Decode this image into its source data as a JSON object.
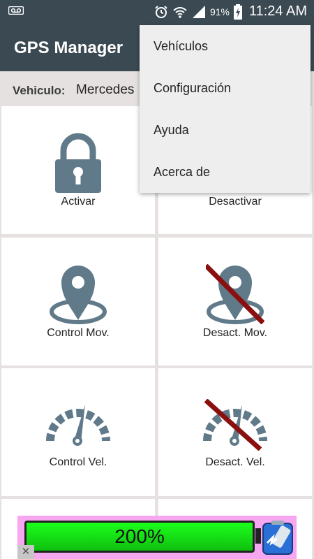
{
  "status_bar": {
    "battery_percent": "91%",
    "time": "11:24 AM",
    "icons": [
      "voicemail-icon",
      "alarm-icon",
      "wifi-icon",
      "signal-icon",
      "battery-charging-icon"
    ]
  },
  "app_bar": {
    "title": "GPS Manager"
  },
  "vehicle": {
    "label": "Vehiculo:",
    "value": "Mercedes"
  },
  "tiles": {
    "activar": {
      "label": "Activar",
      "icon": "lock-icon"
    },
    "desactivar": {
      "label": "Desactivar",
      "icon": "unlock-icon"
    },
    "control_mov": {
      "label": "Control Mov.",
      "icon": "location-pin-icon"
    },
    "desact_mov": {
      "label": "Desact. Mov.",
      "icon": "location-pin-disabled-icon"
    },
    "control_vel": {
      "label": "Control Vel.",
      "icon": "speedometer-icon"
    },
    "desact_vel": {
      "label": "Desact. Vel.",
      "icon": "speedometer-disabled-icon"
    }
  },
  "menu": {
    "items": [
      {
        "label": "Vehículos"
      },
      {
        "label": "Configuración"
      },
      {
        "label": "Ayuda"
      },
      {
        "label": "Acerca de"
      }
    ]
  },
  "ad": {
    "battery_text": "200%",
    "close_label": "✕",
    "icon": "battery-app-icon"
  },
  "colors": {
    "primary": "#3b4a52",
    "icon": "#607a8a",
    "strike": "#8a1010",
    "background": "#e6e1e1",
    "tile": "#ffffff",
    "ad_background": "#f7a6f0"
  }
}
